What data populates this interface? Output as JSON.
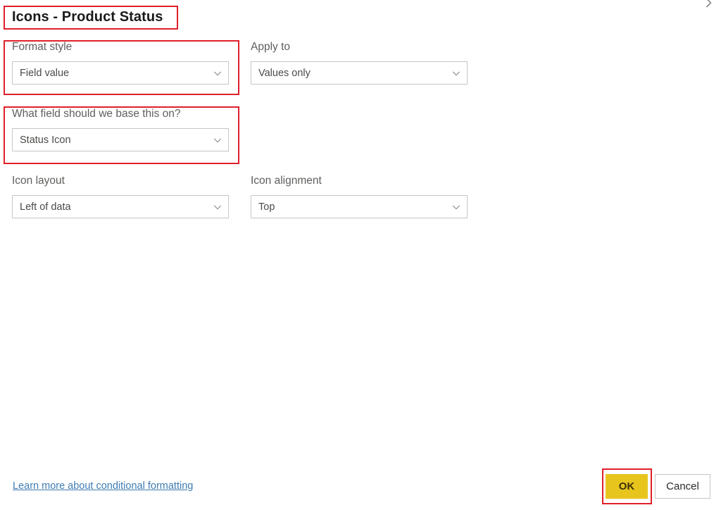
{
  "dialog": {
    "title": "Icons - Product Status",
    "collapse_icon": "chevron-right-icon"
  },
  "fields": [
    {
      "label": "Format style",
      "value": "Field value",
      "name": "format-style",
      "chevron_icon": "chevron-down-icon"
    },
    {
      "label": "Apply to",
      "value": "Values only",
      "name": "apply-to",
      "chevron_icon": "chevron-down-icon"
    },
    {
      "label": "What field should we base this on?",
      "value": "Status Icon",
      "name": "base-field",
      "chevron_icon": "chevron-down-icon"
    },
    {
      "label": "Icon layout",
      "value": "Left of data",
      "name": "icon-layout",
      "chevron_icon": "chevron-down-icon"
    },
    {
      "label": "Icon alignment",
      "value": "Top",
      "name": "icon-alignment",
      "chevron_icon": "chevron-down-icon"
    }
  ],
  "footer": {
    "learn_more_link": "Learn more about conditional formatting",
    "ok_label": "OK",
    "cancel_label": "Cancel"
  },
  "colors": {
    "annotation_red": "#e0202a",
    "primary_button": "#e8c51c",
    "link_blue": "#3e7cb1",
    "label_gray": "#605e5c",
    "border_gray": "#c8c6c4"
  }
}
